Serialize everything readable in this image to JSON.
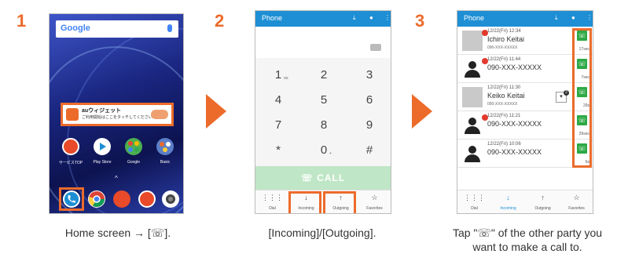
{
  "steps": [
    {
      "number": "1",
      "caption": "Home screen → [☏]."
    },
    {
      "number": "2",
      "caption": "[Incoming]/[Outgoing]."
    },
    {
      "number": "3",
      "caption_line1": "Tap \"☏\" of the other party you",
      "caption_line2": "want to make a call to."
    }
  ],
  "home": {
    "search_label": "Google",
    "widget_title": "auウィジェット",
    "widget_sub": "ご利用開始はここをタッチしてください",
    "apps": [
      {
        "label": "サービスTOP"
      },
      {
        "label": "Play Store"
      },
      {
        "label": "Google"
      },
      {
        "label": "Basic"
      }
    ]
  },
  "dialer": {
    "title": "Phone",
    "keys": [
      {
        "main": "1",
        "sub": "oo"
      },
      {
        "main": "2",
        "sub": ""
      },
      {
        "main": "3",
        "sub": ""
      },
      {
        "main": "4",
        "sub": ""
      },
      {
        "main": "5",
        "sub": ""
      },
      {
        "main": "6",
        "sub": ""
      },
      {
        "main": "7",
        "sub": ""
      },
      {
        "main": "8",
        "sub": ""
      },
      {
        "main": "9",
        "sub": ""
      },
      {
        "main": "*",
        "sub": ""
      },
      {
        "main": "0",
        "sub": "+"
      },
      {
        "main": "#",
        "sub": ""
      }
    ],
    "call_label": "CALL",
    "tabs": [
      {
        "label": "Dial"
      },
      {
        "label": "Incoming"
      },
      {
        "label": "Outgoing"
      },
      {
        "label": "Favorites"
      }
    ]
  },
  "call_log": {
    "title": "Phone",
    "entries": [
      {
        "time": "12/22(Fri) 12:34",
        "name": "Ichiro Keitai",
        "number": "090-XXX-XXXXX",
        "duration": "17sec"
      },
      {
        "time": "12/22(Fri) 11:44",
        "name": "",
        "number": "090-XXX-XXXXX",
        "duration": "7sec"
      },
      {
        "time": "12/22(Fri) 11:30",
        "name": "Keiko Keitai",
        "number": "090-XXX-XXXXX",
        "duration": "29s"
      },
      {
        "time": "12/22(Fri) 11:21",
        "name": "",
        "number": "090-XXX-XXXXX",
        "duration": "29sec"
      },
      {
        "time": "12/22(Fri) 10:06",
        "name": "",
        "number": "090-XXX-XXXXX",
        "duration": "6s"
      }
    ],
    "dropdown_count": "2",
    "tabs": [
      {
        "label": "Dial"
      },
      {
        "label": "Incoming"
      },
      {
        "label": "Outgoing"
      },
      {
        "label": "Favorites"
      }
    ]
  },
  "colors": {
    "accent": "#ec6b2b",
    "appbar": "#1e8fd4",
    "call_green": "#2ea946"
  }
}
